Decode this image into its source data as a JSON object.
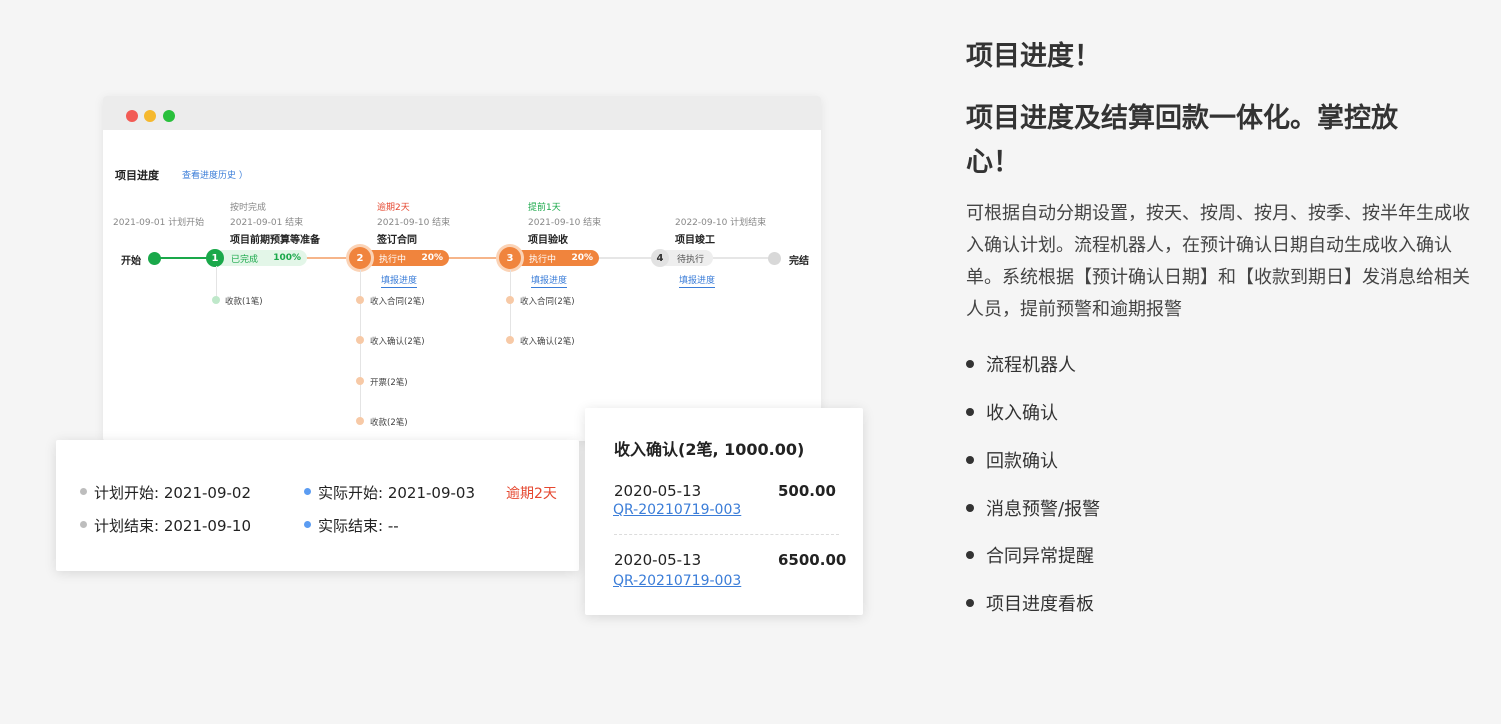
{
  "window": {
    "title": "项目进度",
    "history_link": "查看进度历史 ）",
    "start_label": "开始",
    "end_label": "完结",
    "start_plan": "2021-09-01 计划开始",
    "stages": [
      {
        "num": "1",
        "status_top": "按时完成",
        "date": "2021-09-01 结束",
        "name": "项目前期预算等准备",
        "pill_status": "已完成",
        "percent": "100%",
        "sub_items": [
          "收款(1笔)"
        ]
      },
      {
        "num": "2",
        "status_top": "逾期2天",
        "date": "2021-09-10 结束",
        "name": "签订合同",
        "pill_status": "执行中",
        "percent": "20%",
        "link": "填报进度",
        "sub_items": [
          "收入合同(2笔)",
          "收入确认(2笔)",
          "开票(2笔)",
          "收款(2笔)"
        ]
      },
      {
        "num": "3",
        "status_top": "提前1天",
        "date": "2021-09-10 结束",
        "name": "项目验收",
        "pill_status": "执行中",
        "percent": "20%",
        "link": "填报进度",
        "sub_items": [
          "收入合同(2笔)",
          "收入确认(2笔)"
        ]
      },
      {
        "num": "4",
        "date": "2022-09-10 计划结束",
        "name": "项目竣工",
        "pill_status": "待执行",
        "link": "填报进度"
      }
    ]
  },
  "popup_left": {
    "plan_start": "计划开始: 2021-09-02",
    "plan_end": "计划结束: 2021-09-10",
    "actual_start": "实际开始: 2021-09-03",
    "actual_end": "实际结束: --",
    "overdue": "逾期2天"
  },
  "popup_right": {
    "title": "收入确认(2笔, 1000.00)",
    "entries": [
      {
        "date": "2020-05-13",
        "amount": "500.00",
        "code": "QR-20210719-003"
      },
      {
        "date": "2020-05-13",
        "amount": "6500.00",
        "code": "QR-20210719-003"
      }
    ]
  },
  "right": {
    "heading1": "项目进度！",
    "heading2_line1": "项目进度及结算回款一体化。掌控放",
    "heading2_line2": "心！",
    "paragraph": "可根据自动分期设置，按天、按周、按月、按季、按半年生成收入确认计划。流程机器人，在预计确认日期自动生成收入确认单。系统根据【预计确认日期】和【收款到期日】发消息给相关人员，提前预警和逾期报警",
    "features": [
      "流程机器人",
      "收入确认",
      "回款确认",
      "消息预警/报警",
      "合同异常提醒",
      "项目进度看板"
    ]
  },
  "colors": {
    "green": "#1aa84a",
    "orange": "#f0843d",
    "gray": "#d8d8d8",
    "blue": "#3b7dd8",
    "red": "#e5472f"
  }
}
